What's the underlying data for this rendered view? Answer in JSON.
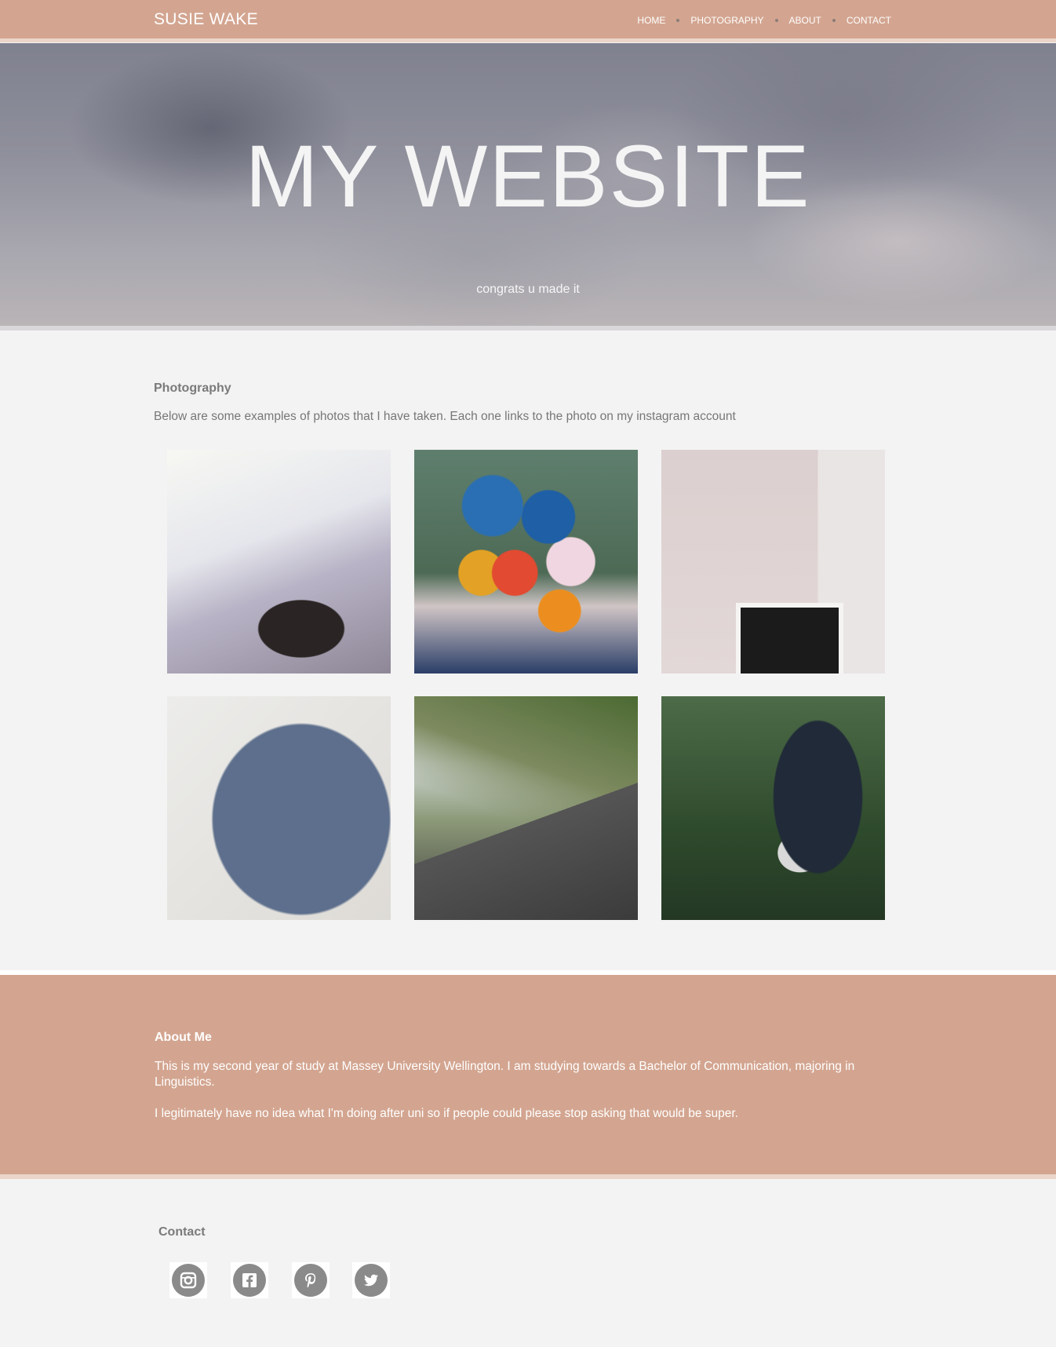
{
  "nav": {
    "brand": "SUSIE WAKE",
    "items": [
      {
        "label": "HOME"
      },
      {
        "label": "PHOTOGRAPHY"
      },
      {
        "label": "ABOUT"
      },
      {
        "label": "CONTACT"
      }
    ]
  },
  "hero": {
    "title": "MY WEBSITE",
    "subtitle": "congrats u made it"
  },
  "photography": {
    "title": "Photography",
    "description": "Below are some examples of photos that I have taken. Each one links to the photo on my instagram account",
    "photos": [
      {
        "subject": "dog on bed"
      },
      {
        "subject": "balloons"
      },
      {
        "subject": "be still frame"
      },
      {
        "subject": "jeans"
      },
      {
        "subject": "road through hills"
      },
      {
        "subject": "strawberry picking"
      }
    ]
  },
  "about": {
    "title": "About Me",
    "p1": "This is my second year of study at Massey University Wellington. I am studying towards a Bachelor of Communication, majoring in Linguistics.",
    "p2": "I legitimately have no idea what I'm doing after uni so if people could please stop asking that would be super."
  },
  "contact": {
    "title": "Contact",
    "icons": [
      "instagram-icon",
      "facebook-icon",
      "pinterest-icon",
      "twitter-icon"
    ]
  },
  "colors": {
    "accent": "#d3a590",
    "background": "#f3f3f3",
    "icon": "#8a8a8a"
  }
}
